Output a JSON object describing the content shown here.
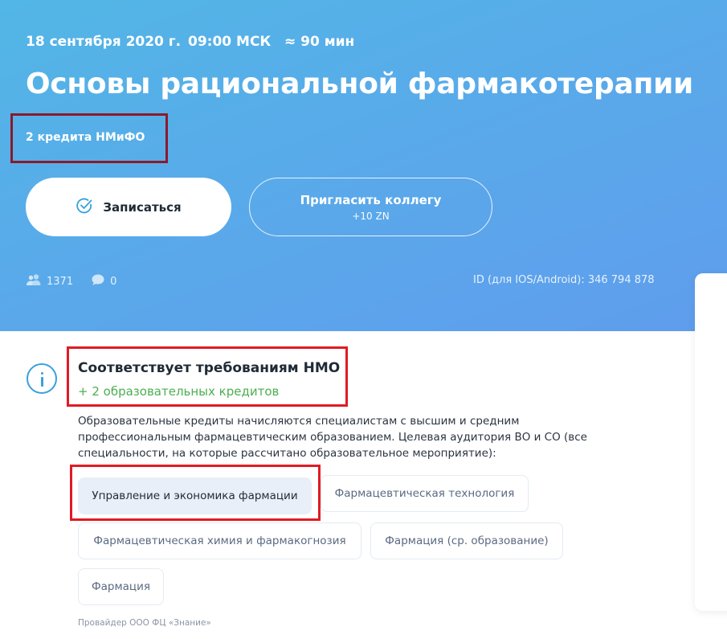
{
  "event": {
    "date": "18 сентября 2020 г.",
    "time": "09:00 МСК",
    "duration": "≈ 90 мин",
    "title": "Основы рациональной фармакотерапии",
    "credits": "2 кредита НМиФО"
  },
  "actions": {
    "enroll_label": "Записаться",
    "invite_label": "Пригласить коллегу",
    "invite_bonus": "+10 ZN"
  },
  "stats": {
    "participants": "1371",
    "comments": "0",
    "app_id": "ID (для IOS/Android): 346 794 878"
  },
  "nmo": {
    "title": "Соответствует требованиям НМО",
    "credits_line": "+ 2 образовательных кредитов",
    "description": "Образовательные кредиты начисляются специалистам с высшим и средним профессиональным фармацевтическим образованием. Целевая аудитория ВО и СО (все специальности, на которые рассчитано образовательное мероприятие):"
  },
  "specialties": [
    {
      "label": "Управление и экономика фармации",
      "selected": true
    },
    {
      "label": "Фармацевтическая технология",
      "selected": false
    },
    {
      "label": "Фармацевтическая химия и фармакогнозия",
      "selected": false
    },
    {
      "label": "Фармация (ср. образование)",
      "selected": false
    },
    {
      "label": "Фармация",
      "selected": false
    }
  ],
  "provider": "Провайдер ООО ФЦ «Знание»",
  "colors": {
    "hero_start": "#52b6e6",
    "hero_end": "#5f9ded",
    "accent_blue": "#3aa0dc",
    "success_green": "#4caf50",
    "highlight_red": "#e01b24",
    "credits_box": "#8b1a2a"
  }
}
